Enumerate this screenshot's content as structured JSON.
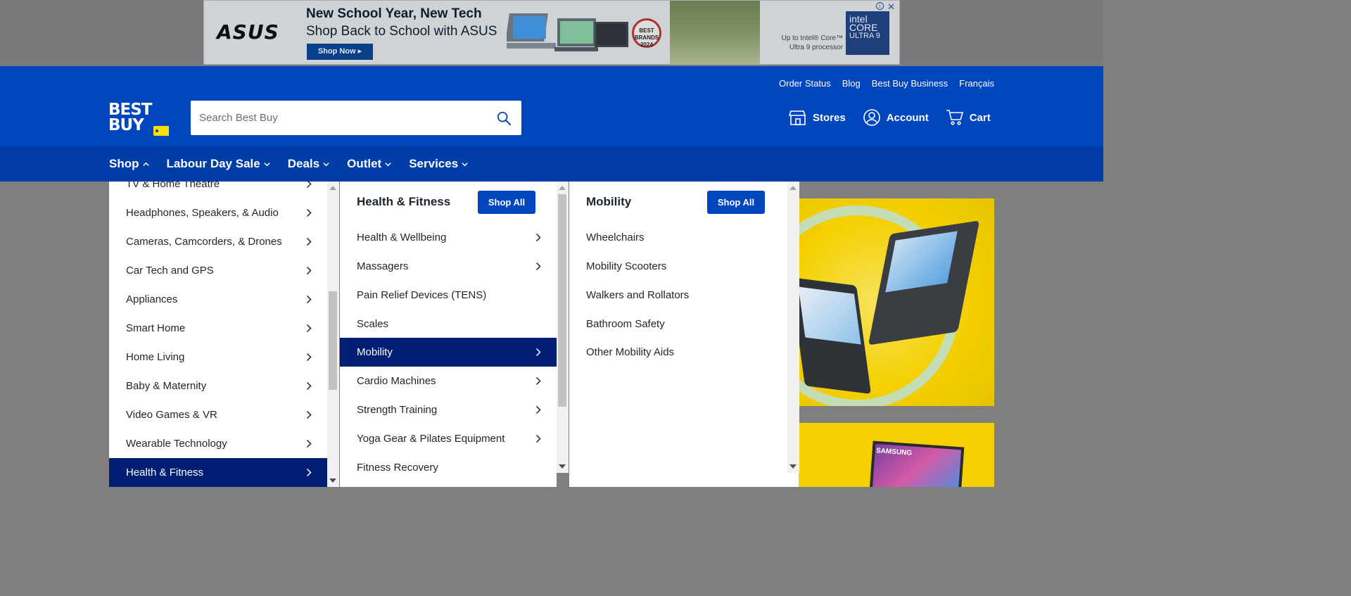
{
  "ad": {
    "brand": "ASUS",
    "title": "New School Year, New Tech",
    "subtitle": "Shop Back to School with ASUS",
    "cta": "Shop Now ▸",
    "badge": "BEST BRANDS 2024",
    "processor_line1": "Up to Intel® Core™",
    "processor_line2": "Ultra 9 processor",
    "intel_logo": "intel CORE",
    "intel_tier": "ULTRA 9"
  },
  "header": {
    "util_links": [
      "Order Status",
      "Blog",
      "Best Buy Business",
      "Français"
    ],
    "logo_line1": "BEST",
    "logo_line2": "BUY",
    "search_placeholder": "Search Best Buy",
    "actions": {
      "stores": "Stores",
      "account": "Account",
      "cart": "Cart"
    }
  },
  "nav": {
    "items": [
      "Shop",
      "Labour Day Sale",
      "Deals",
      "Outlet",
      "Services"
    ]
  },
  "menu": {
    "categories": [
      "TV & Home Theatre",
      "Headphones, Speakers, & Audio",
      "Cameras, Camcorders, & Drones",
      "Car Tech and GPS",
      "Appliances",
      "Smart Home",
      "Home Living",
      "Baby & Maternity",
      "Video Games & VR",
      "Wearable Technology",
      "Health & Fitness"
    ],
    "active_category": "Health & Fitness",
    "subpanel": {
      "title": "Health & Fitness",
      "shop_all": "Shop All",
      "items": [
        "Health & Wellbeing",
        "Massagers",
        "Pain Relief Devices (TENS)",
        "Scales",
        "Mobility",
        "Cardio Machines",
        "Strength Training",
        "Yoga Gear & Pilates Equipment",
        "Fitness Recovery"
      ],
      "active_item": "Mobility"
    },
    "detail": {
      "title": "Mobility",
      "shop_all": "Shop All",
      "items": [
        "Wheelchairs",
        "Mobility Scooters",
        "Walkers and Rollators",
        "Bathroom Safety",
        "Other Mobility Aids"
      ]
    }
  },
  "promo": {
    "tv_brand": "SAMSUNG"
  },
  "colors": {
    "brand_blue": "#0046be",
    "nav_blue": "#003da6",
    "active_navy": "#001e73",
    "tag_yellow": "#ffe000"
  }
}
